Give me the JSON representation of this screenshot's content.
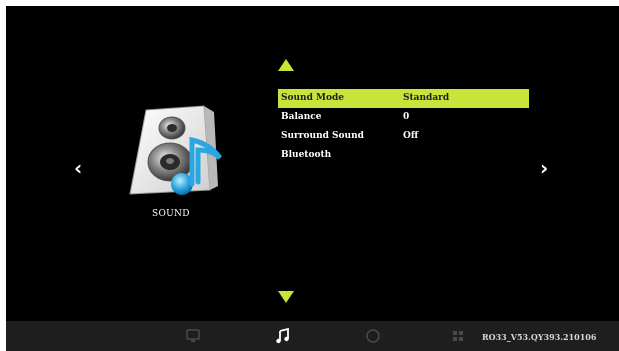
{
  "title": "SOUND",
  "menu": {
    "items": [
      {
        "label": "Sound Mode",
        "value": "Standard"
      },
      {
        "label": "Balance",
        "value": "0"
      },
      {
        "label": "Surround Sound",
        "value": "Off"
      },
      {
        "label": "Bluetooth",
        "value": ""
      }
    ],
    "selected_index": 0
  },
  "navigation": {
    "prev": "‹",
    "next": "›"
  },
  "bottom_bar": {
    "tabs": [
      {
        "icon": "picture-icon",
        "active": false
      },
      {
        "icon": "music-note-icon",
        "active": true
      },
      {
        "icon": "clock-icon",
        "active": false
      },
      {
        "icon": "grid-icon",
        "active": false
      }
    ],
    "version": "RO33_V53.QY393.210106"
  },
  "colors": {
    "highlight": "#c9e33a",
    "background": "#000000",
    "bar": "#1e1e1e"
  }
}
